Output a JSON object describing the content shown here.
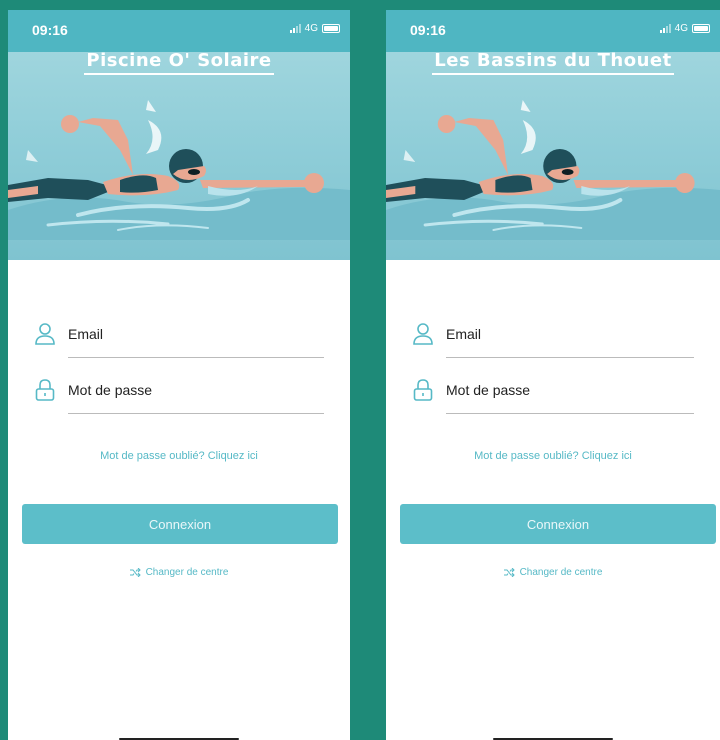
{
  "screens": [
    {
      "status": {
        "time": "09:16",
        "network": "4G"
      },
      "center_name": "Piscine O' Solaire",
      "email_label": "Email",
      "password_label": "Mot de passe",
      "forgot_link": "Mot de passe oublié? Cliquez ici",
      "login_button": "Connexion",
      "switch_center": "Changer de centre"
    },
    {
      "status": {
        "time": "09:16",
        "network": "4G"
      },
      "center_name": "Les Bassins du Thouet",
      "email_label": "Email",
      "password_label": "Mot de passe",
      "forgot_link": "Mot de passe oublié? Cliquez ici",
      "login_button": "Connexion",
      "switch_center": "Changer de centre"
    }
  ],
  "colors": {
    "background": "#1e8a78",
    "accent": "#5cbec9",
    "hero": "#8fcdd8",
    "status_bar": "#4fb6c2"
  },
  "icons": [
    "user-icon",
    "lock-icon",
    "shuffle-icon",
    "signal-icon",
    "battery-icon"
  ]
}
